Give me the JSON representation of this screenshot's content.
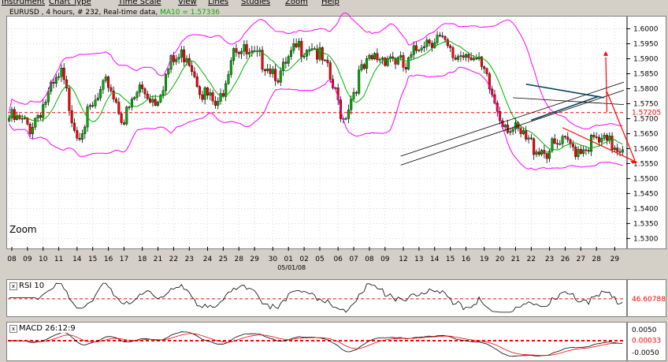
{
  "menu": [
    "Instrument",
    "Chart Type",
    "Time Scale",
    "View",
    "Lines",
    "Studies",
    "Zoom",
    "Help"
  ],
  "header": {
    "info": "EURUSD , 4 hours, # 232, Real-time data",
    "ma": "MA10 = 1.57336"
  },
  "zoom_label": "Zoom",
  "colors": {
    "candle_up": "#00b000",
    "candle_down": "#ff0000",
    "ma": "#00b000",
    "bollinger": "#ff00ff",
    "level": "#ff0000",
    "arrow": "#ff0000",
    "trend": "#000000",
    "rsi_line": "#000000",
    "macd_line": "#000000",
    "signal_line": "#ff0000"
  },
  "chart_data": [
    {
      "type": "candlestick",
      "title": "EURUSD , 4 hours, # 232, Real-time data",
      "y_ticks": [
        "1.6000",
        "1.5950",
        "1.5900",
        "1.5850",
        "1.5800",
        "1.5750",
        "1.5700",
        "1.5650",
        "1.5600",
        "1.5550",
        "1.5500",
        "1.5450",
        "1.5400",
        "1.5350",
        "1.5300"
      ],
      "x_ticks": [
        "08",
        "09",
        "10",
        "11",
        "14",
        "15",
        "16",
        "17",
        "18",
        "21",
        "22",
        "23",
        "24",
        "25",
        "28",
        "29",
        "30",
        "01",
        "02",
        "05",
        "06",
        "07",
        "08",
        "09",
        "12",
        "13",
        "14",
        "15",
        "16",
        "19",
        "20",
        "21",
        "22",
        "23",
        "26",
        "27",
        "28",
        "29"
      ],
      "x_tick_index": [
        1,
        7,
        13,
        19,
        26,
        32,
        38,
        44,
        51,
        57,
        63,
        69,
        76,
        82,
        88,
        94,
        101,
        107,
        113,
        119,
        126,
        132,
        138,
        144,
        151,
        157,
        163,
        169,
        175,
        182,
        188,
        194,
        200,
        207,
        213,
        219,
        225,
        232
      ],
      "date_label": "05/01/08",
      "ylim": [
        1.528,
        1.6033
      ],
      "current_level": {
        "value": 1.57205,
        "label": "1.57205"
      },
      "ma_label": "MA10 = 1.57336",
      "key_closes": [
        [
          0,
          1.572
        ],
        [
          8,
          1.569
        ],
        [
          14,
          1.578
        ],
        [
          20,
          1.586
        ],
        [
          26,
          1.567
        ],
        [
          32,
          1.575
        ],
        [
          38,
          1.584
        ],
        [
          44,
          1.571
        ],
        [
          50,
          1.582
        ],
        [
          56,
          1.578
        ],
        [
          62,
          1.59
        ],
        [
          68,
          1.594
        ],
        [
          74,
          1.581
        ],
        [
          80,
          1.575
        ],
        [
          86,
          1.597
        ],
        [
          92,
          1.592
        ],
        [
          98,
          1.591
        ],
        [
          104,
          1.586
        ],
        [
          110,
          1.595
        ],
        [
          116,
          1.597
        ],
        [
          122,
          1.587
        ],
        [
          128,
          1.572
        ],
        [
          134,
          1.586
        ],
        [
          140,
          1.592
        ],
        [
          146,
          1.593
        ],
        [
          152,
          1.588
        ],
        [
          158,
          1.598
        ],
        [
          164,
          1.599
        ],
        [
          170,
          1.592
        ],
        [
          176,
          1.595
        ],
        [
          182,
          1.586
        ],
        [
          188,
          1.573
        ],
        [
          194,
          1.567
        ],
        [
          200,
          1.563
        ],
        [
          206,
          1.561
        ],
        [
          212,
          1.563
        ],
        [
          218,
          1.562
        ],
        [
          224,
          1.564
        ],
        [
          230,
          1.563
        ]
      ],
      "candles_note": "",
      "series": []
    },
    {
      "type": "line",
      "title": "RSI 10",
      "level": {
        "value": 46.60788,
        "label": "46.60788"
      },
      "ylim": [
        0,
        100
      ]
    },
    {
      "type": "line",
      "title": "MACD 26:12:9",
      "y_ticks": [
        "0.0050",
        "0.00033",
        "-0.0050"
      ],
      "levels": [
        0.00033,
        0
      ],
      "ylim": [
        -0.0075,
        0.0075
      ]
    }
  ]
}
